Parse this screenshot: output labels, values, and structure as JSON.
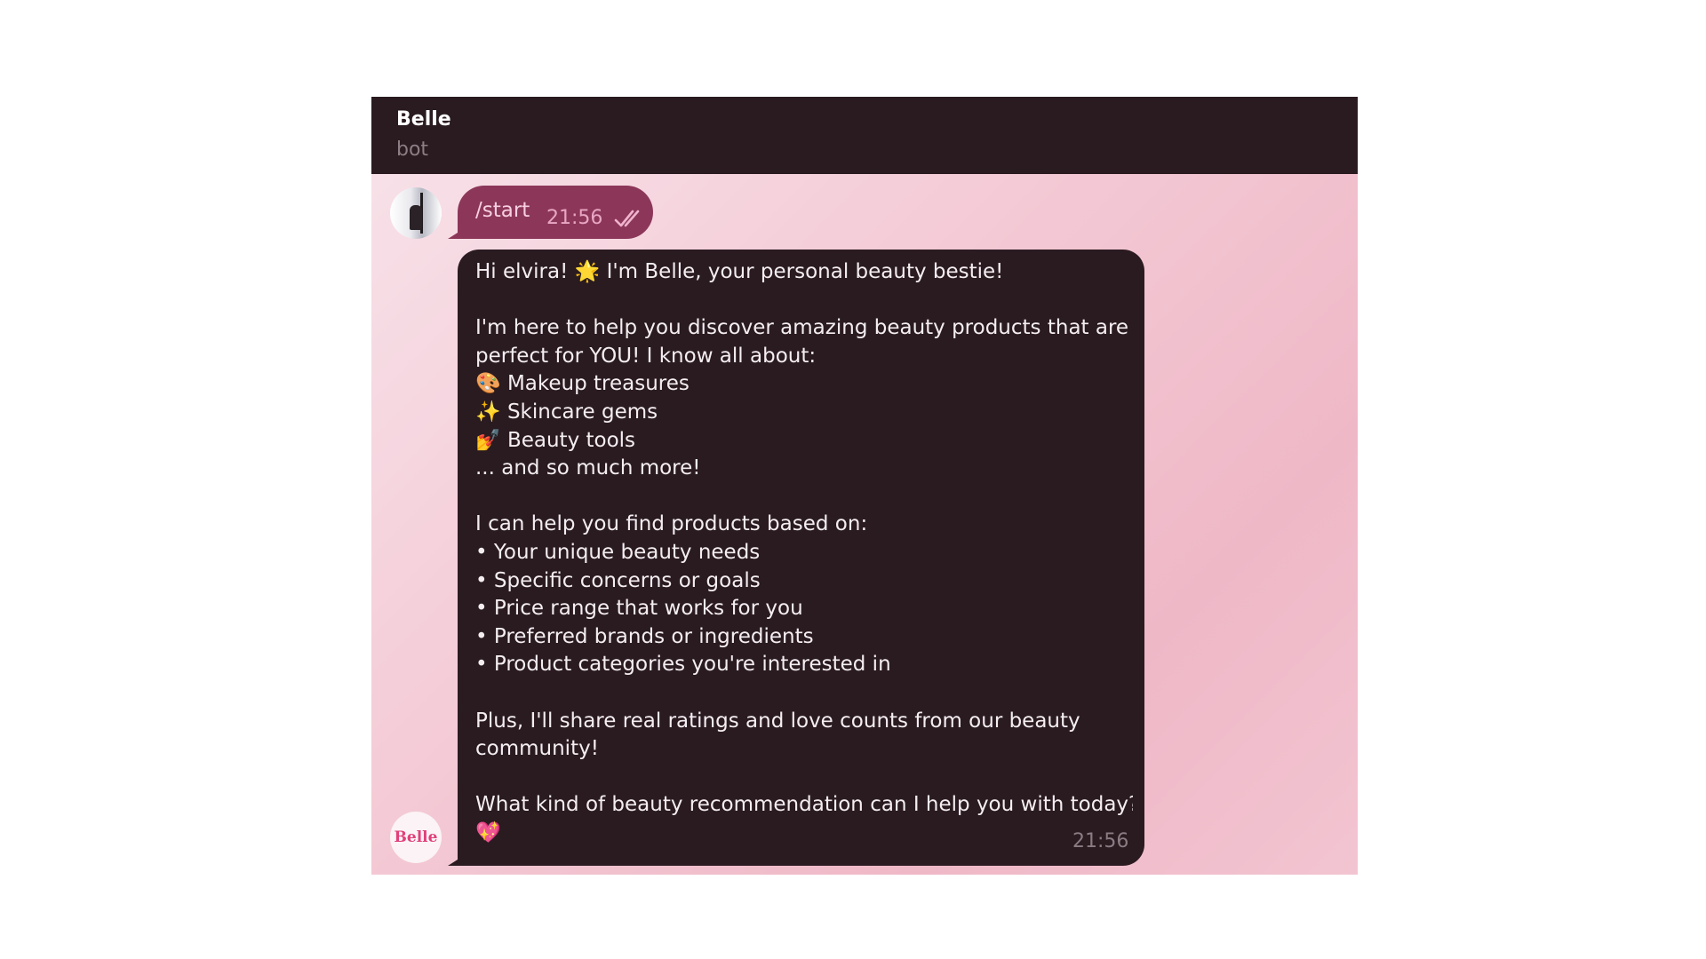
{
  "header": {
    "title": "Belle",
    "subtitle": "bot"
  },
  "bot_avatar_label": "Belle",
  "outgoing": {
    "text": "/start",
    "time": "21:56",
    "status_icon": "double-check-icon"
  },
  "incoming": {
    "lines": [
      "Hi elvira! 🌟 I'm Belle, your personal beauty bestie!",
      "",
      "I'm here to help you discover amazing beauty products that are",
      "perfect for YOU! I know all about:",
      "🎨 Makeup treasures",
      "✨ Skincare gems",
      "💅 Beauty tools",
      "... and so much more!",
      "",
      "I can help you find products based on:",
      "• Your unique beauty needs",
      "• Specific concerns or goals",
      "• Price range that works for you",
      "• Preferred brands or ingredients",
      "• Product categories you're interested in",
      "",
      "Plus, I'll share real ratings and love counts from our beauty",
      "community!",
      "",
      "What kind of beauty recommendation can I help you with today?",
      "💖"
    ],
    "time": "21:56"
  },
  "colors": {
    "header_bg": "#291b20",
    "outgoing_bubble": "#8c3759",
    "incoming_bubble": "#2a1b21",
    "accent_pink": "#e0407a"
  }
}
